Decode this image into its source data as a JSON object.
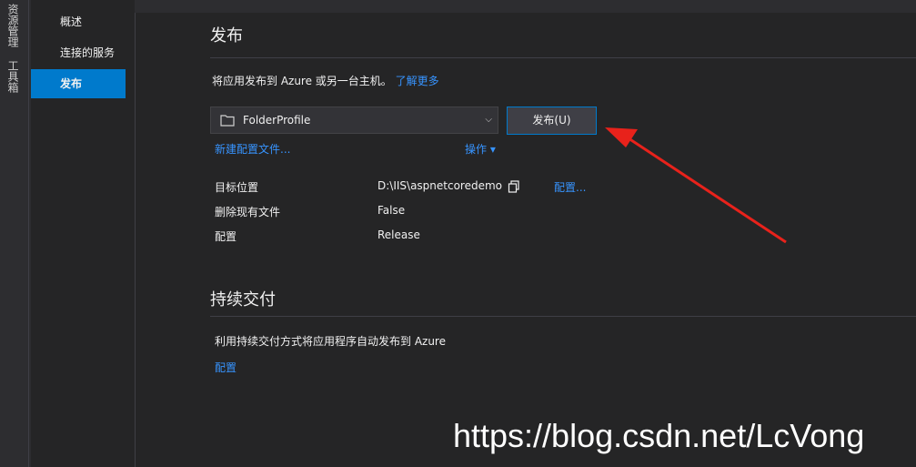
{
  "side_tabs": [
    "资源管理器",
    "工具箱"
  ],
  "nav": {
    "items": [
      {
        "label": "概述"
      },
      {
        "label": "连接的服务"
      },
      {
        "label": "发布"
      }
    ]
  },
  "publish": {
    "title": "发布",
    "description": "将应用发布到 Azure 或另一台主机。",
    "learn_more": "了解更多",
    "profile_select": "FolderProfile",
    "publish_button": "发布(U)",
    "new_profile": "新建配置文件...",
    "actions": "操作",
    "rows": [
      {
        "label": "目标位置",
        "value": "D:\\IIS\\aspnetcoredemo"
      },
      {
        "label": "删除现有文件",
        "value": "False"
      },
      {
        "label": "配置",
        "value": "Release"
      }
    ],
    "configure": "配置..."
  },
  "continuous_delivery": {
    "title": "持续交付",
    "description": "利用持续交付方式将应用程序自动发布到 Azure",
    "configure": "配置"
  },
  "watermark": "https://blog.csdn.net/LcVong",
  "colors": {
    "accent": "#007acc",
    "link": "#3794ff",
    "arrow": "#e8221b"
  }
}
